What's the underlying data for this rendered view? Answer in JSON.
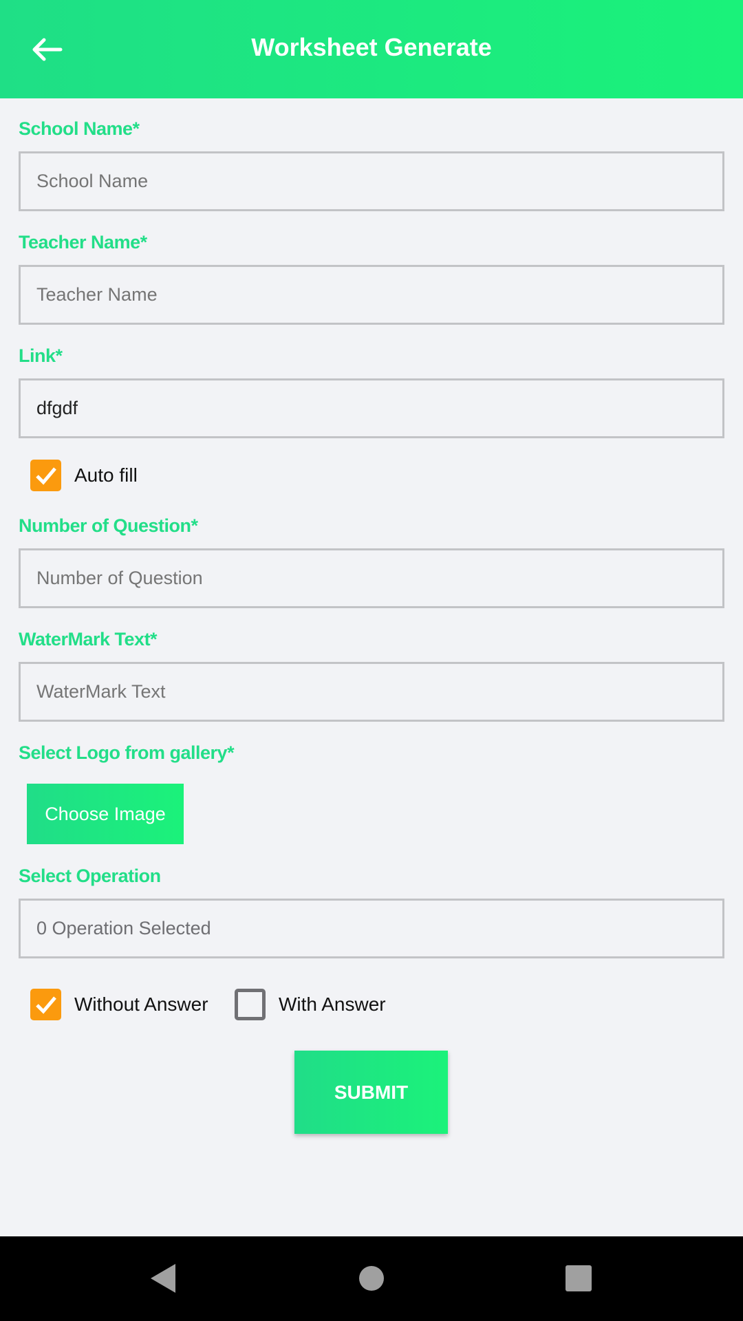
{
  "header": {
    "title": "Worksheet Generate",
    "back_icon": "arrow-left-icon"
  },
  "form": {
    "school_name": {
      "label": "School Name*",
      "placeholder": "School Name",
      "value": ""
    },
    "teacher_name": {
      "label": "Teacher Name*",
      "placeholder": "Teacher Name",
      "value": ""
    },
    "link": {
      "label": "Link*",
      "value": "dfgdf"
    },
    "auto_fill": {
      "label": "Auto fill",
      "checked": true
    },
    "number_of_question": {
      "label": "Number of Question*",
      "placeholder": "Number of Question",
      "value": ""
    },
    "watermark": {
      "label": "WaterMark Text*",
      "placeholder": "WaterMark Text",
      "value": ""
    },
    "logo": {
      "label": "Select Logo from gallery*",
      "button": "Choose Image"
    },
    "operation": {
      "label": "Select Operation",
      "value": "0 Operation Selected"
    },
    "without_answer": {
      "label": "Without Answer",
      "checked": true
    },
    "with_answer": {
      "label": "With Answer",
      "checked": false
    },
    "submit": "SUBMIT"
  },
  "colors": {
    "accent": "#1fe585",
    "checkbox": "#fb9a0e",
    "label": "#22de88"
  },
  "navbar": {
    "icons": [
      "back-triangle-icon",
      "home-circle-icon",
      "recents-square-icon"
    ]
  }
}
